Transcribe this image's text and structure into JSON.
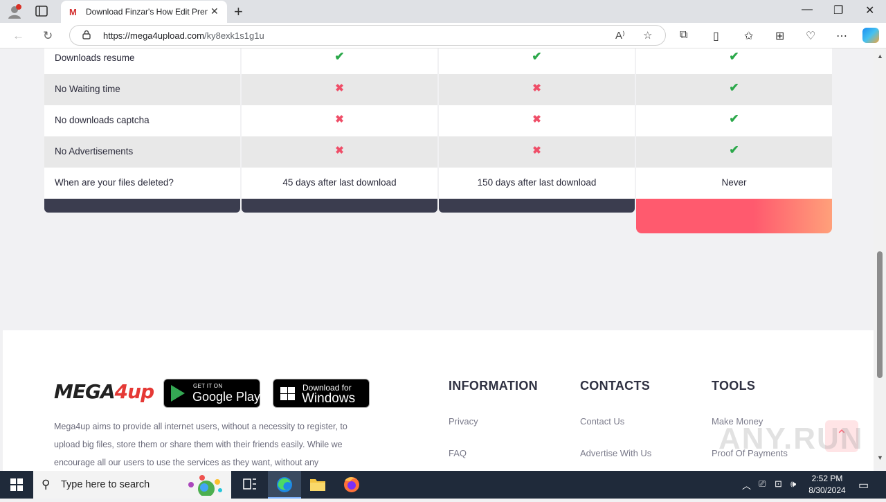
{
  "browser": {
    "tab_title": "Download Finzar's How Edit Pren",
    "tab_favicon": "M",
    "url_host": "https://mega4upload.com",
    "url_path": "/ky8exk1s1g1u",
    "icons": [
      "profile-icon",
      "tab-actions-icon",
      "back-icon",
      "refresh-icon",
      "lock-icon",
      "read-aloud-icon",
      "favorite-star-icon",
      "extensions-icon",
      "split-screen-icon",
      "favorites-icon",
      "collections-icon",
      "browser-essentials-icon",
      "more-icon",
      "copilot-icon"
    ]
  },
  "comparison": {
    "rows": [
      {
        "feature": "Downloads resume",
        "plans": [
          "check",
          "check",
          "check"
        ]
      },
      {
        "feature": "No Waiting time",
        "plans": [
          "cross",
          "cross",
          "check"
        ]
      },
      {
        "feature": "No downloads captcha",
        "plans": [
          "cross",
          "cross",
          "check"
        ]
      },
      {
        "feature": "No Advertisements",
        "plans": [
          "cross",
          "cross",
          "check"
        ]
      },
      {
        "feature": "When are your files deleted?",
        "plans": [
          "45 days after last download",
          "150 days after last download",
          "Never"
        ]
      }
    ],
    "symbols": {
      "check": "✔",
      "cross": "✖"
    },
    "colors": {
      "check": "#2ba84a",
      "cross": "#ef4e68",
      "plan_footer": "#3b3d4f",
      "premium_footer_start": "#ff5a6e",
      "premium_footer_end": "#ffa07a"
    }
  },
  "footer": {
    "logo_text_a": "MEGA",
    "logo_text_b": "4up",
    "google_play_small": "GET IT ON",
    "google_play_big": "Google Play",
    "windows_small": "Download for",
    "windows_big": "Windows",
    "about": "Mega4up aims to provide all internet users, without a necessity to register, to upload big files, store them or share them with their friends easily. While we encourage all our users to use the services as they want, without any",
    "columns": [
      {
        "title": "INFORMATION",
        "links": [
          "Privacy",
          "FAQ"
        ]
      },
      {
        "title": "CONTACTS",
        "links": [
          "Contact Us",
          "Advertise With Us"
        ]
      },
      {
        "title": "TOOLS",
        "links": [
          "Make Money",
          "Proof Of Payments"
        ]
      }
    ],
    "watermark": "ANY.RUN"
  },
  "taskbar": {
    "search_placeholder": "Type here to search",
    "time": "2:52 PM",
    "date": "8/30/2024"
  }
}
